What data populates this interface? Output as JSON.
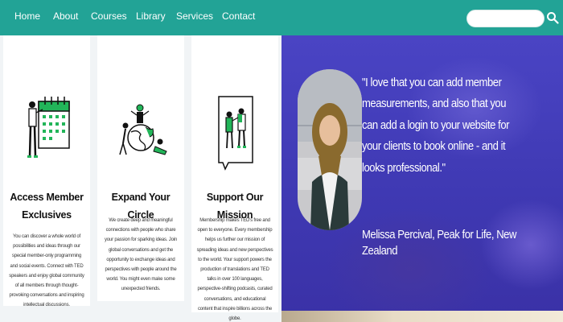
{
  "nav": {
    "items": [
      {
        "label": "Home"
      },
      {
        "label": "About"
      },
      {
        "label": "Courses"
      },
      {
        "label": "Library"
      },
      {
        "label": "Services"
      },
      {
        "label": "Contact"
      }
    ],
    "search": {
      "placeholder": "",
      "icon": "search-icon"
    }
  },
  "cards": [
    {
      "title": "Access Member Exclusives",
      "description": "You can discover a whole world of possibilities and ideas through our special member-only programming and social events. Connect with TED speakers and enjoy global community of all members through thought-provoking conversations and inspiring intellectual discussions.",
      "icon": "calendar-illustration"
    },
    {
      "title": "Expand Your Circle",
      "description": "We create deep and meaningful connections with people who share your passion for sparking ideas. Join global conversations and get the opportunity to exchange ideas and perspectives with people around the world. You might even make some unexpected friends.",
      "icon": "globe-people-illustration"
    },
    {
      "title": "Support Our Mission",
      "description": "Membership makes TED's free and open to everyone. Every membership helps us further our mission of spreading ideas and new perspectives to the world. Your support powers the production of translations and TED talks in over 100 languages, perspective-shifting podcasts, curated conversations, and educational content that inspire billions across the globe.",
      "icon": "people-board-illustration"
    }
  ],
  "testimonial": {
    "quote": "\"I love that you can add member measurements, and also that you can add a login to your website for your clients to book online - and it looks professional.\"",
    "author": "Melissa Percival, Peak for Life, New Zealand"
  },
  "colors": {
    "nav_bg": "#22a396",
    "accent_green": "#22b559",
    "testimonial_bg": "#4338b8"
  }
}
